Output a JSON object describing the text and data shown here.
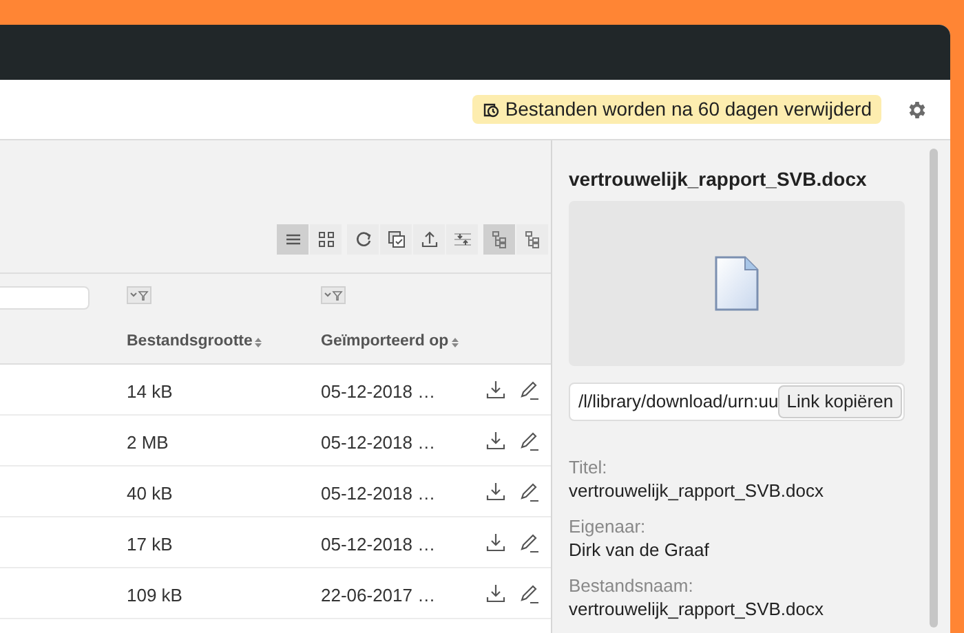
{
  "notice": {
    "text": "Bestanden worden na 60 dagen verwijderd"
  },
  "toolbar": {
    "view_buttons": [
      {
        "selected": true
      },
      {
        "selected": false
      }
    ],
    "action_buttons": [
      {
        "kind": "refresh"
      },
      {
        "kind": "copy"
      },
      {
        "kind": "upload"
      },
      {
        "kind": "split"
      }
    ],
    "tree_buttons": [
      {
        "selected": true
      },
      {
        "selected": false
      }
    ]
  },
  "table": {
    "columns": [
      {
        "label": "Bestandsgrootte",
        "filter": true
      },
      {
        "label": "Geïmporteerd op",
        "filter": true
      }
    ],
    "rows": [
      {
        "size": "14 kB",
        "imported": "05-12-2018 …"
      },
      {
        "size": "2 MB",
        "imported": "05-12-2018 …"
      },
      {
        "size": "40 kB",
        "imported": "05-12-2018 …"
      },
      {
        "size": "17 kB",
        "imported": "05-12-2018 …"
      },
      {
        "size": "109 kB",
        "imported": "22-06-2017 …"
      }
    ]
  },
  "details": {
    "title": "vertrouwelijk_rapport_SVB.docx",
    "link": {
      "value": "/l/library/download/urn:uu",
      "button": "Link kopiëren"
    },
    "fields": [
      {
        "label": "Titel:",
        "value": "vertrouwelijk_rapport_SVB.docx"
      },
      {
        "label": "Eigenaar:",
        "value": "Dirk van de Graaf"
      },
      {
        "label": "Bestandsnaam:",
        "value": "vertrouwelijk_rapport_SVB.docx"
      }
    ]
  }
}
